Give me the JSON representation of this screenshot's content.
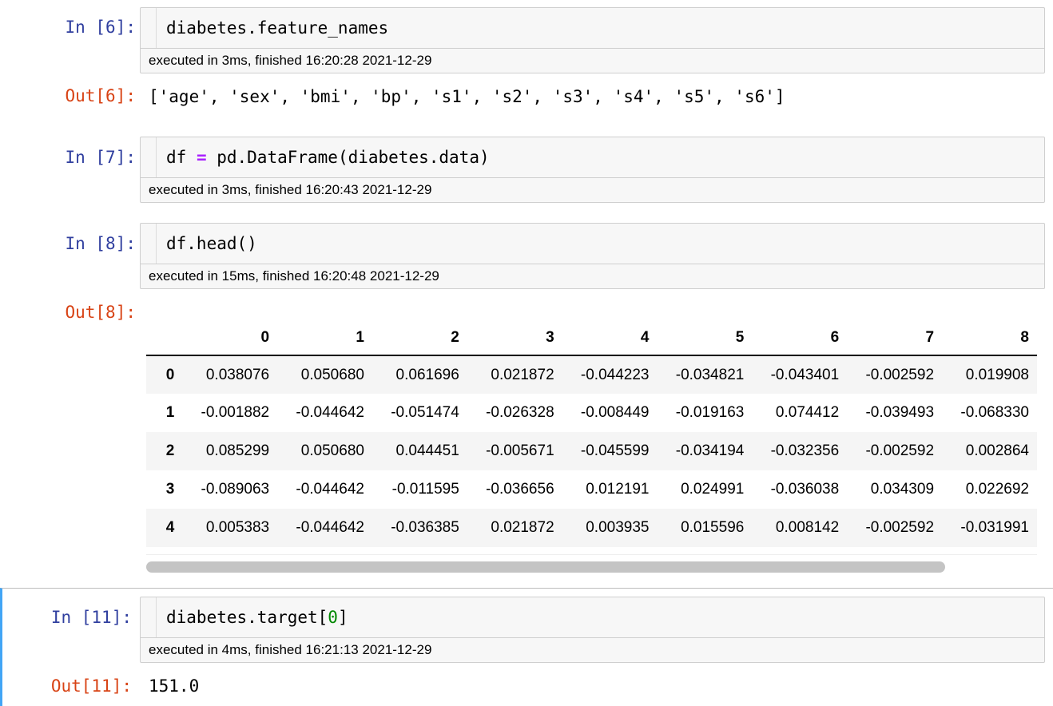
{
  "cells": {
    "c6": {
      "in_prompt": "In [6]:",
      "code": "diabetes.feature_names",
      "exec_info": "executed in 3ms, finished 16:20:28 2021-12-29",
      "out_prompt": "Out[6]:",
      "output": "['age', 'sex', 'bmi', 'bp', 's1', 's2', 's3', 's4', 's5', 's6']"
    },
    "c7": {
      "in_prompt": "In [7]:",
      "code_a": "df ",
      "code_op": "=",
      "code_b": " pd.DataFrame(diabetes.data)",
      "exec_info": "executed in 3ms, finished 16:20:43 2021-12-29"
    },
    "c8": {
      "in_prompt": "In [8]:",
      "code": "df.head()",
      "exec_info": "executed in 15ms, finished 16:20:48 2021-12-29",
      "out_prompt": "Out[8]:"
    },
    "c11": {
      "in_prompt": "In [11]:",
      "code_a": "diabetes.target[",
      "code_num": "0",
      "code_b": "]",
      "exec_info": "executed in 4ms, finished 16:21:13 2021-12-29",
      "out_prompt": "Out[11]:",
      "output": "151.0"
    }
  },
  "dataframe": {
    "columns": [
      "0",
      "1",
      "2",
      "3",
      "4",
      "5",
      "6",
      "7",
      "8"
    ],
    "rows": [
      {
        "index": "0",
        "values": [
          "0.038076",
          "0.050680",
          "0.061696",
          "0.021872",
          "-0.044223",
          "-0.034821",
          "-0.043401",
          "-0.002592",
          "0.019908"
        ]
      },
      {
        "index": "1",
        "values": [
          "-0.001882",
          "-0.044642",
          "-0.051474",
          "-0.026328",
          "-0.008449",
          "-0.019163",
          "0.074412",
          "-0.039493",
          "-0.068330"
        ]
      },
      {
        "index": "2",
        "values": [
          "0.085299",
          "0.050680",
          "0.044451",
          "-0.005671",
          "-0.045599",
          "-0.034194",
          "-0.032356",
          "-0.002592",
          "0.002864"
        ]
      },
      {
        "index": "3",
        "values": [
          "-0.089063",
          "-0.044642",
          "-0.011595",
          "-0.036656",
          "0.012191",
          "0.024991",
          "-0.036038",
          "0.034309",
          "0.022692"
        ]
      },
      {
        "index": "4",
        "values": [
          "0.005383",
          "-0.044642",
          "-0.036385",
          "0.021872",
          "0.003935",
          "0.015596",
          "0.008142",
          "-0.002592",
          "-0.031991"
        ]
      }
    ]
  },
  "colors": {
    "in_prompt": "#303f9f",
    "out_prompt": "#d84315",
    "selected_border": "#42a5f5"
  }
}
